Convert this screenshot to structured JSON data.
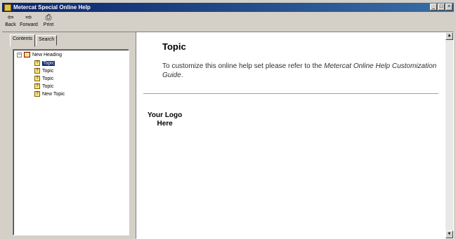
{
  "window": {
    "title": "Metercat Special Online Help"
  },
  "toolbar": {
    "back_label": "Back",
    "forward_label": "Forward",
    "print_label": "Print"
  },
  "tabs": {
    "contents": "Contents",
    "search": "Search"
  },
  "tree": {
    "heading": "New Heading",
    "items": [
      "Topic",
      "Topic",
      "Topic",
      "Topic",
      "New Topic"
    ]
  },
  "content": {
    "title": "Topic",
    "body_prefix": "To customize this online help set please refer to the ",
    "body_italic": "Metercat Online Help Customization Guide",
    "body_suffix": ".",
    "logo_line1": "Your Logo",
    "logo_line2": "Here"
  }
}
